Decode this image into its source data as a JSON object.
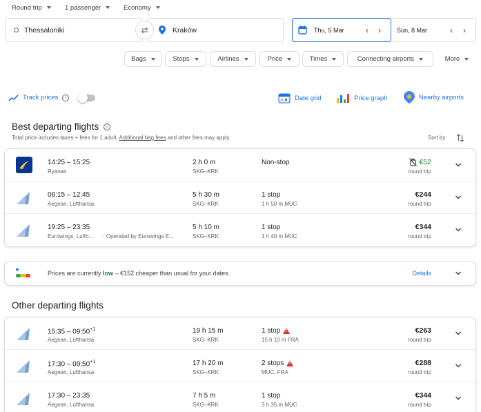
{
  "search": {
    "trip_type": "Round trip",
    "passengers": "1 passenger",
    "cabin": "Economy",
    "origin": "Thessaloniki",
    "destination": "Kraków",
    "depart_date": "Thu, 5 Mar",
    "return_date": "Sun, 8 Mar"
  },
  "filters": [
    "Bags",
    "Stops",
    "Airlines",
    "Price",
    "Times",
    "Connecting airports"
  ],
  "more_label": "More",
  "toolbar": {
    "track_prices": "Track prices",
    "date_grid": "Date grid",
    "price_graph": "Price graph",
    "nearby_airports": "Nearby airports"
  },
  "best": {
    "title": "Best departing flights",
    "subtitle_pre": "Total price includes taxes + fees for 1 adult.",
    "subtitle_link": "Additional bag fees",
    "subtitle_post": "and other fees may apply.",
    "sort_label": "Sort by:",
    "flights": [
      {
        "times": "14:25 – 15:25",
        "plus": "",
        "airline": "Ryanair",
        "operated": "",
        "duration": "2 h 0 m",
        "route": "SKG–KRK",
        "stops": "Non-stop",
        "stop_detail": "",
        "price": "€52",
        "round_trip": "round trip"
      },
      {
        "times": "08:15 – 12:45",
        "plus": "",
        "airline": "Aegean, Lufthansa",
        "operated": "",
        "duration": "5 h 30 m",
        "route": "SKG–KRK",
        "stops": "1 stop",
        "stop_detail": "1 h 50 m MUC",
        "price": "€244",
        "round_trip": "round trip"
      },
      {
        "times": "19:25 – 23:35",
        "plus": "",
        "airline": "Eurowings, Lufth...",
        "operated": "· Operated by Eurowings E...",
        "duration": "5 h 10 m",
        "route": "SKG–KRK",
        "stops": "1 stop",
        "stop_detail": "1 h 40 m MUC",
        "price": "€344",
        "round_trip": "round trip"
      }
    ]
  },
  "insight": {
    "pre": "Prices are currently",
    "level": "low",
    "post": "– €152 cheaper than usual for your dates.",
    "details": "Details"
  },
  "other": {
    "title": "Other departing flights",
    "flights": [
      {
        "times": "15:35 – 09:50",
        "plus": "+1",
        "airline": "Aegean, Lufthansa",
        "duration": "19 h 15 m",
        "route": "SKG–KRK",
        "stops": "1 stop",
        "stop_detail": "15 h 10 m FRA",
        "price": "€263",
        "round_trip": "round trip"
      },
      {
        "times": "17:30 – 09:50",
        "plus": "+1",
        "airline": "Aegean, Lufthansa",
        "duration": "17 h 20 m",
        "route": "SKG–KRK",
        "stops": "2 stops",
        "stop_detail": "MUC, FRA",
        "price": "€288",
        "round_trip": "round trip"
      },
      {
        "times": "17:30 – 23:35",
        "plus": "",
        "airline": "Aegean, Lufthansa",
        "duration": "7 h 5 m",
        "route": "SKG–KRK",
        "stops": "1 stop",
        "stop_detail": "3 h 35 m MUC",
        "price": "€344",
        "round_trip": "round trip"
      }
    ]
  },
  "colors": {
    "accent": "#1a73e8",
    "green": "#188038",
    "warning": "#d93025",
    "ryanair_navy": "#073590",
    "ryanair_gold": "#f1c933",
    "aegean_blue": "#5b8fc7"
  }
}
